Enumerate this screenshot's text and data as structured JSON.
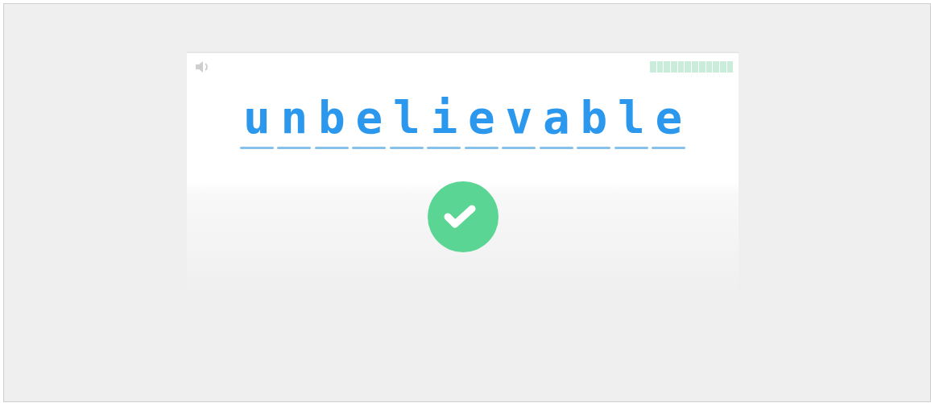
{
  "progress": {
    "level": 1
  },
  "letters": [
    "u",
    "n",
    "b",
    "e",
    "l",
    "i",
    "e",
    "v",
    "a",
    "b",
    "l",
    "e"
  ],
  "result": {
    "correct": true
  }
}
